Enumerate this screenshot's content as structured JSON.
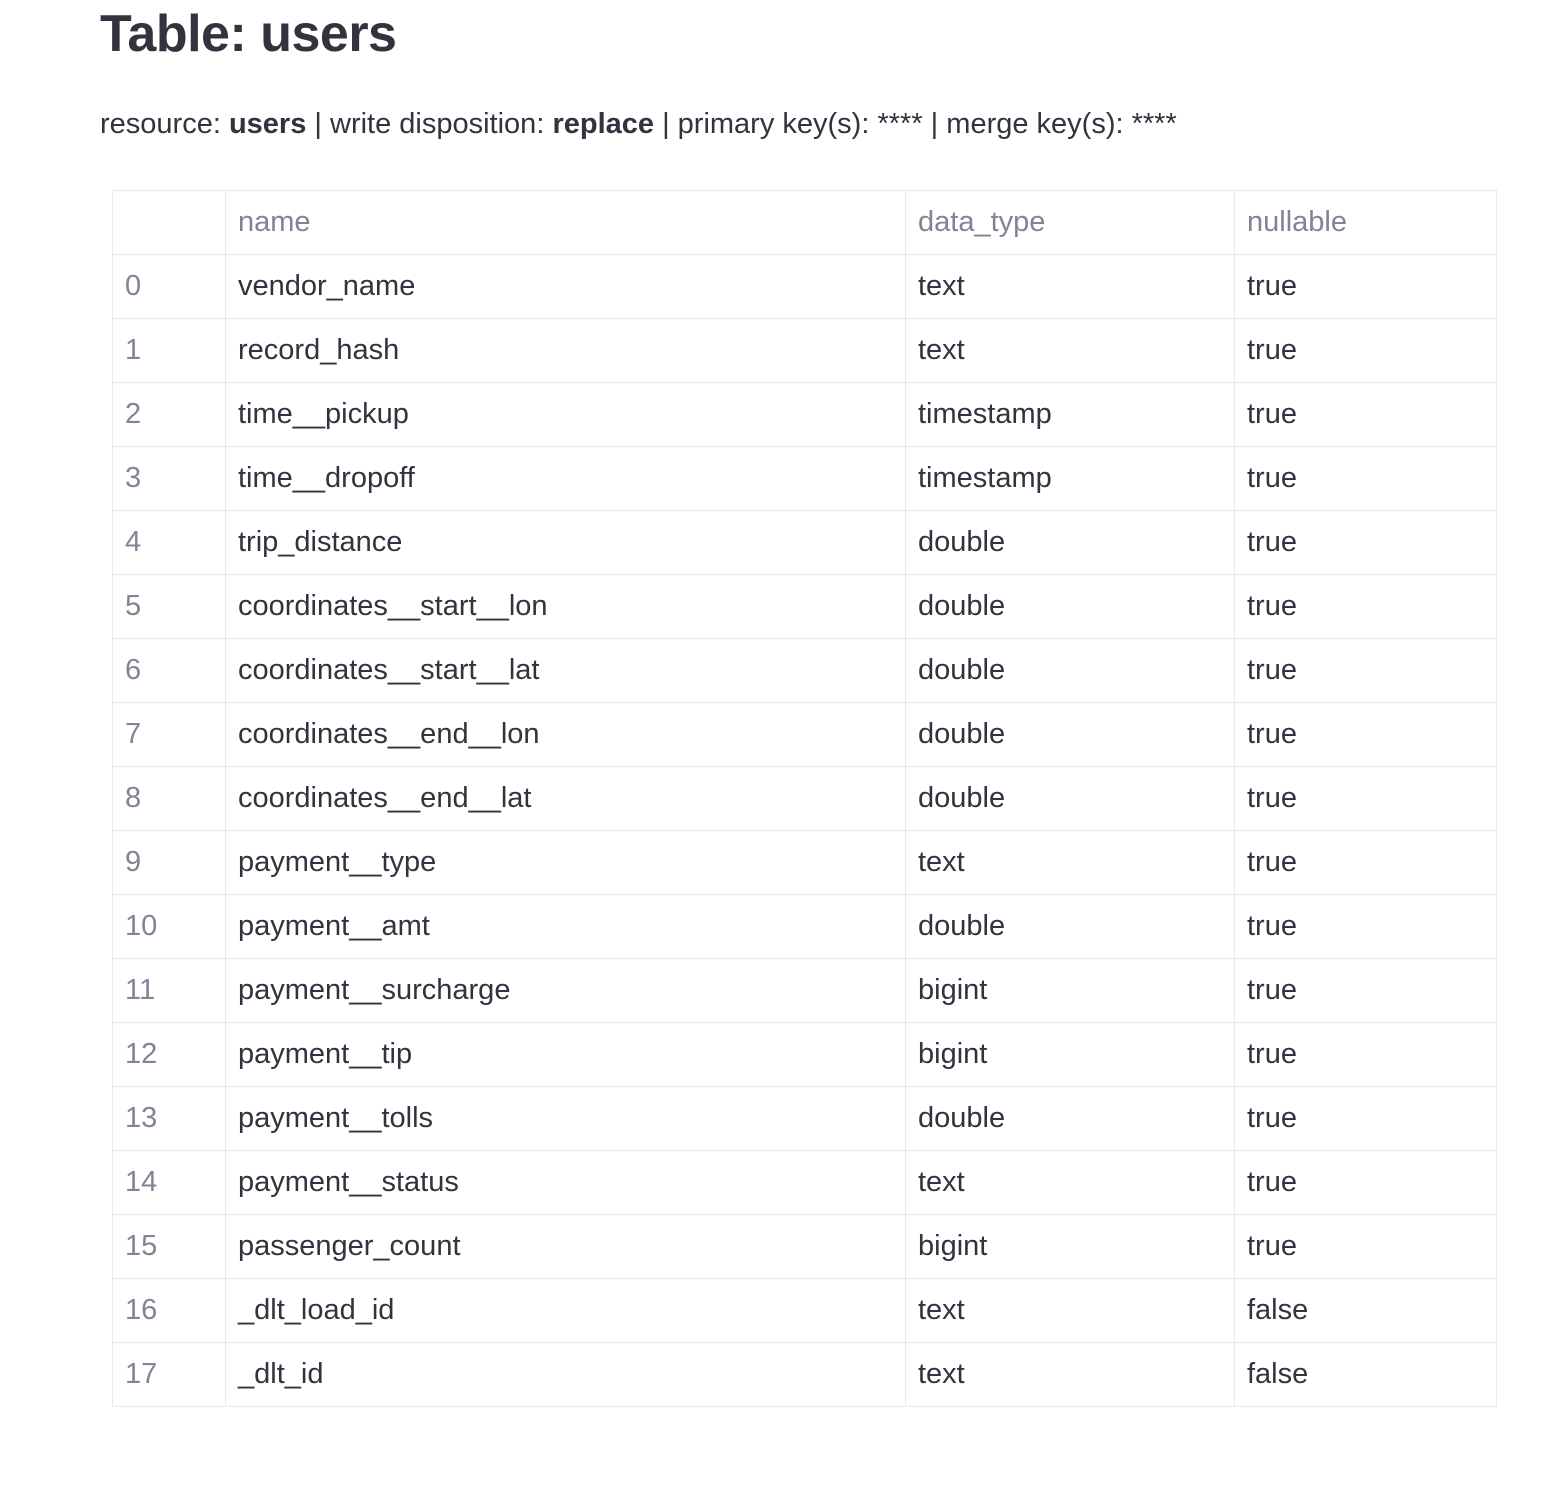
{
  "page": {
    "title": "Table: users"
  },
  "meta": {
    "resource_label": "resource: ",
    "resource_value": "users",
    "sep1": " | ",
    "write_disposition_label": "write disposition: ",
    "write_disposition_value": "replace",
    "sep2": " | ",
    "primary_key_label": "primary key(s): ",
    "primary_key_value": "****",
    "sep3": " | ",
    "merge_key_label": "merge key(s): ",
    "merge_key_value": "****"
  },
  "table": {
    "columns": [
      "",
      "name",
      "data_type",
      "nullable"
    ],
    "rows": [
      {
        "index": "0",
        "name": "vendor_name",
        "data_type": "text",
        "nullable": "true"
      },
      {
        "index": "1",
        "name": "record_hash",
        "data_type": "text",
        "nullable": "true"
      },
      {
        "index": "2",
        "name": "time__pickup",
        "data_type": "timestamp",
        "nullable": "true"
      },
      {
        "index": "3",
        "name": "time__dropoff",
        "data_type": "timestamp",
        "nullable": "true"
      },
      {
        "index": "4",
        "name": "trip_distance",
        "data_type": "double",
        "nullable": "true"
      },
      {
        "index": "5",
        "name": "coordinates__start__lon",
        "data_type": "double",
        "nullable": "true"
      },
      {
        "index": "6",
        "name": "coordinates__start__lat",
        "data_type": "double",
        "nullable": "true"
      },
      {
        "index": "7",
        "name": "coordinates__end__lon",
        "data_type": "double",
        "nullable": "true"
      },
      {
        "index": "8",
        "name": "coordinates__end__lat",
        "data_type": "double",
        "nullable": "true"
      },
      {
        "index": "9",
        "name": "payment__type",
        "data_type": "text",
        "nullable": "true"
      },
      {
        "index": "10",
        "name": "payment__amt",
        "data_type": "double",
        "nullable": "true"
      },
      {
        "index": "11",
        "name": "payment__surcharge",
        "data_type": "bigint",
        "nullable": "true"
      },
      {
        "index": "12",
        "name": "payment__tip",
        "data_type": "bigint",
        "nullable": "true"
      },
      {
        "index": "13",
        "name": "payment__tolls",
        "data_type": "double",
        "nullable": "true"
      },
      {
        "index": "14",
        "name": "payment__status",
        "data_type": "text",
        "nullable": "true"
      },
      {
        "index": "15",
        "name": "passenger_count",
        "data_type": "bigint",
        "nullable": "true"
      },
      {
        "index": "16",
        "name": "_dlt_load_id",
        "data_type": "text",
        "nullable": "false"
      },
      {
        "index": "17",
        "name": "_dlt_id",
        "data_type": "text",
        "nullable": "false"
      }
    ]
  }
}
